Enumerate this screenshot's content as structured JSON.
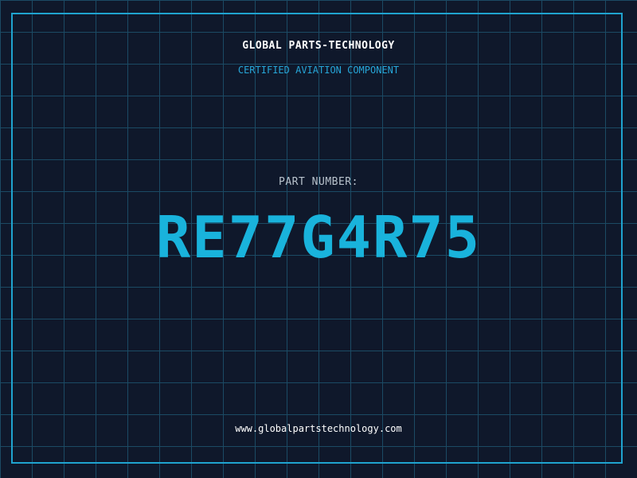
{
  "header": {
    "brand": "GLOBAL PARTS-TECHNOLOGY",
    "subtitle": "CERTIFIED AVIATION COMPONENT"
  },
  "part": {
    "label": "PART NUMBER:",
    "number": "RE77G4R75"
  },
  "footer": {
    "url": "www.globalpartstechnology.com"
  },
  "colors": {
    "background": "#0f182b",
    "grid": "#1b4a64",
    "accent": "#19b3dc",
    "label": "#b8c2cc",
    "text": "#ffffff"
  }
}
